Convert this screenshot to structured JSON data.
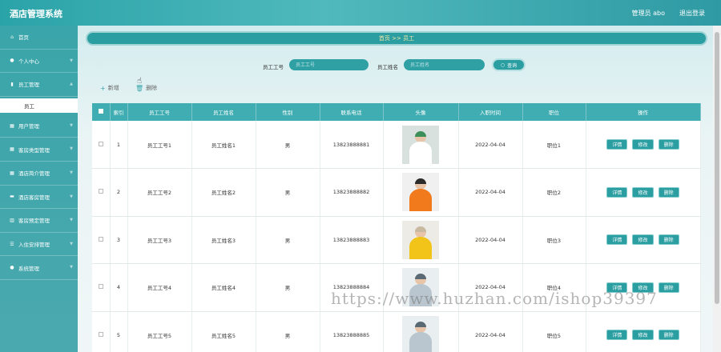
{
  "header": {
    "title": "酒店管理系统",
    "user": "管理员 abo",
    "logout": "退出登录"
  },
  "sidebar": {
    "items": [
      {
        "label": "首页",
        "icon": "home-icon",
        "glyph": "⌂"
      },
      {
        "label": "个人中心",
        "icon": "user-icon",
        "glyph": "●"
      },
      {
        "label": "员工管理",
        "icon": "chart-icon",
        "glyph": "▮"
      },
      {
        "label": "用户管理",
        "icon": "grid-icon",
        "glyph": "▦"
      },
      {
        "label": "客房类型管理",
        "icon": "grid-icon",
        "glyph": "▦"
      },
      {
        "label": "酒店简介管理",
        "icon": "grid-icon",
        "glyph": "▦"
      },
      {
        "label": "酒店客房管理",
        "icon": "card-icon",
        "glyph": "▬"
      },
      {
        "label": "客房预定管理",
        "icon": "bar-chart-icon",
        "glyph": "▥"
      },
      {
        "label": "入住安排管理",
        "icon": "list-icon",
        "glyph": "☰"
      },
      {
        "label": "系统管理",
        "icon": "user-icon",
        "glyph": "●"
      }
    ],
    "submenu": {
      "label": "员工"
    }
  },
  "breadcrumb": "首页 >> 员工",
  "search": {
    "label_no": "员工工号",
    "placeholder_no": "员工工号",
    "label_name": "员工姓名",
    "placeholder_name": "员工姓名",
    "button": "查询"
  },
  "actions": {
    "add": "新增",
    "delete": "删除"
  },
  "table": {
    "headers": [
      "索引",
      "员工工号",
      "员工姓名",
      "性别",
      "联系电话",
      "头像",
      "入职时间",
      "职位",
      "操作"
    ],
    "rows": [
      {
        "index": "1",
        "no": "员工工号1",
        "name": "员工姓名1",
        "gender": "男",
        "phone": "13823888881",
        "date": "2022-04-04",
        "position": "职位1"
      },
      {
        "index": "2",
        "no": "员工工号2",
        "name": "员工姓名2",
        "gender": "男",
        "phone": "13823888882",
        "date": "2022-04-04",
        "position": "职位2"
      },
      {
        "index": "3",
        "no": "员工工号3",
        "name": "员工姓名3",
        "gender": "男",
        "phone": "13823888883",
        "date": "2022-04-04",
        "position": "职位3"
      },
      {
        "index": "4",
        "no": "员工工号4",
        "name": "员工姓名4",
        "gender": "男",
        "phone": "13823888884",
        "date": "2022-04-04",
        "position": "职位4"
      },
      {
        "index": "5",
        "no": "员工工号5",
        "name": "员工姓名5",
        "gender": "男",
        "phone": "13823888885",
        "date": "2022-04-04",
        "position": "职位5"
      }
    ],
    "row_actions": {
      "detail": "详情",
      "edit": "修改",
      "delete": "删除"
    }
  },
  "watermark": "https://www.huzhan.com/ishop39397",
  "colors": {
    "primary": "#2b9ea2",
    "header": "#3fadb1",
    "breadcrumb_text": "#f7e7a6"
  }
}
